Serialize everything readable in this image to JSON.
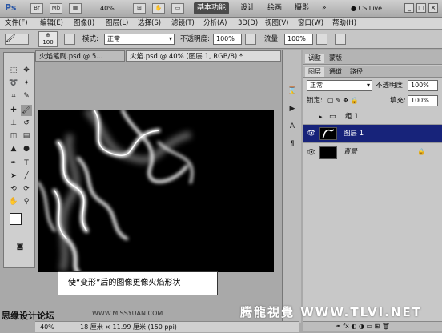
{
  "appbar": {
    "logo": "Ps",
    "zoom": "40%",
    "workspaces": [
      "基本功能",
      "设计",
      "绘画",
      "摄影"
    ],
    "cs_live": "CS Live",
    "icons": [
      "bridge-icon",
      "mini-bridge-icon",
      "view-extras-icon",
      "arrange-docs-icon",
      "screen-mode-icon"
    ]
  },
  "menu": [
    "文件(F)",
    "编辑(E)",
    "图像(I)",
    "图层(L)",
    "选择(S)",
    "滤镜(T)",
    "分析(A)",
    "3D(D)",
    "视图(V)",
    "窗口(W)",
    "帮助(H)"
  ],
  "options": {
    "brush_size": "100",
    "mode_label": "模式:",
    "mode_value": "正常",
    "opacity_label": "不透明度:",
    "opacity_value": "100%",
    "flow_label": "流量:",
    "flow_value": "100%"
  },
  "tabs": {
    "tab1": "火焰笔刷.psd @ 5...",
    "tab2": "火焰.psd @ 40% (图层 1, RGB/8) *"
  },
  "caption": "使“变形”后的图像更像火焰形状",
  "status": {
    "zoom": "40%",
    "doc_info": "18 厘米 × 11.99 厘米 (150 ppi)"
  },
  "panels": {
    "top_tabs": [
      "调整",
      "蒙版"
    ],
    "layer_tabs": [
      "图层",
      "通道",
      "路径"
    ],
    "blend_mode": "正常",
    "opacity_label": "不透明度:",
    "opacity_value": "100%",
    "lock_label": "锁定:",
    "fill_label": "填充:",
    "fill_value": "100%"
  },
  "layers": [
    {
      "name": "组 1",
      "visible": false,
      "selected": false,
      "kind": "group"
    },
    {
      "name": "图层 1",
      "visible": true,
      "selected": true,
      "kind": "layer"
    },
    {
      "name": "背景",
      "visible": true,
      "selected": false,
      "kind": "background"
    }
  ],
  "watermark": {
    "left_text": "思缘设计论坛",
    "site_text": "WWW.MISSYUAN.COM",
    "right_text": "腾龍視覺 WWW.TLVI.NET"
  },
  "colors": {
    "accent": "#17237a",
    "workspace_active": "#4b4b4b"
  }
}
